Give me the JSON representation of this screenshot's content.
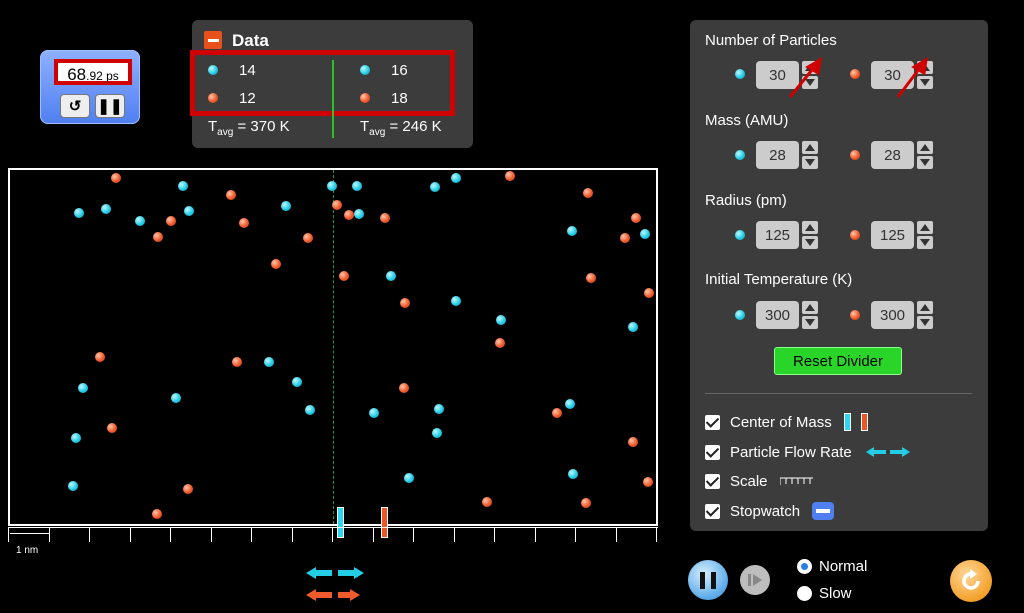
{
  "stopwatch": {
    "time_big": "68",
    "time_small": ".92 ps",
    "reset_icon": "rewind-icon",
    "pause_icon": "pause-icon"
  },
  "data_panel": {
    "title": "Data",
    "left": {
      "cyan_count": "14",
      "red_count": "12",
      "tavg_prefix": "T",
      "tavg_sub": "avg",
      "tavg_value": " = 370 K"
    },
    "right": {
      "cyan_count": "16",
      "red_count": "18",
      "tavg_prefix": "T",
      "tavg_sub": "avg",
      "tavg_value": " = 246 K"
    }
  },
  "scale": {
    "label": "1 nm"
  },
  "controls": {
    "num_particles": {
      "label": "Number of Particles",
      "cyan": "30",
      "red": "30"
    },
    "mass": {
      "label": "Mass (AMU)",
      "cyan": "28",
      "red": "28"
    },
    "radius": {
      "label": "Radius (pm)",
      "cyan": "125",
      "red": "125"
    },
    "initial_temp": {
      "label": "Initial Temperature (K)",
      "cyan": "300",
      "red": "300"
    },
    "reset_divider": "Reset Divider",
    "checkboxes": {
      "center_of_mass": "Center of Mass",
      "particle_flow_rate": "Particle Flow Rate",
      "scale": "Scale",
      "stopwatch": "Stopwatch"
    }
  },
  "speed": {
    "normal": "Normal",
    "slow": "Slow",
    "selected": "Normal"
  },
  "colors": {
    "cyan": "#23cde6",
    "red": "#f05a2c",
    "panel": "#3c3c3c",
    "highlight": "#d00000",
    "reset_green": "#2ad52a"
  }
}
